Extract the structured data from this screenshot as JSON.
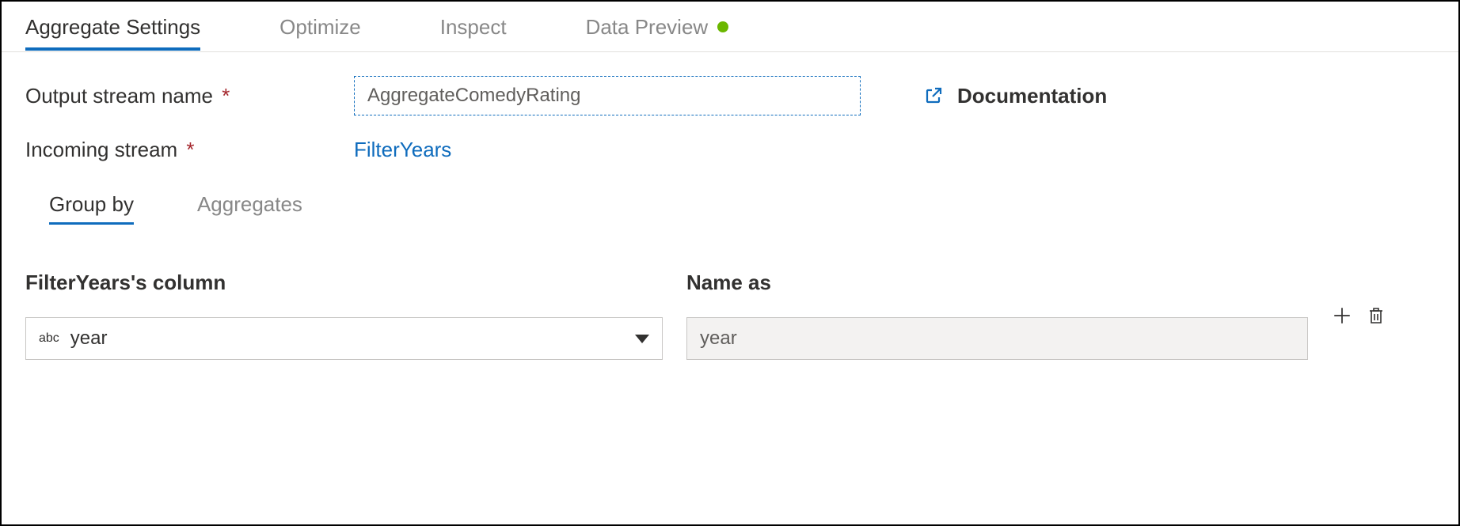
{
  "tabs": {
    "aggregate_settings": "Aggregate Settings",
    "optimize": "Optimize",
    "inspect": "Inspect",
    "data_preview": "Data Preview"
  },
  "form": {
    "output_stream_label": "Output stream name",
    "output_stream_value": "AggregateComedyRating",
    "incoming_stream_label": "Incoming stream",
    "incoming_stream_value": "FilterYears",
    "documentation_label": "Documentation"
  },
  "subtabs": {
    "group_by": "Group by",
    "aggregates": "Aggregates"
  },
  "columns": {
    "source_header": "FilterYears's column",
    "name_as_header": "Name as",
    "type_badge": "abc",
    "column_value": "year",
    "name_as_value": "year"
  }
}
